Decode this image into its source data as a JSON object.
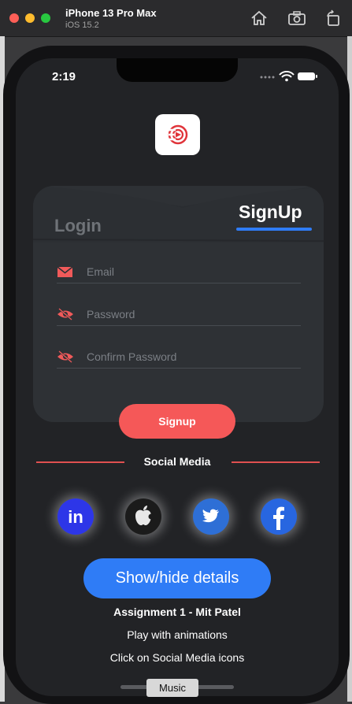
{
  "simulator": {
    "device_name": "iPhone 13 Pro Max",
    "os_version": "iOS 15.2",
    "toolbar_icons": [
      "home-icon",
      "screenshot-icon",
      "rotate-icon"
    ]
  },
  "status_bar": {
    "time": "2:19"
  },
  "auth_card": {
    "tab_login": "Login",
    "tab_signup": "SignUp",
    "active_tab": "SignUp",
    "email_placeholder": "Email",
    "password_placeholder": "Password",
    "confirm_password_placeholder": "Confirm Password",
    "signup_button": "Signup"
  },
  "social": {
    "title": "Social Media",
    "icons": [
      "linkedin-icon",
      "apple-icon",
      "twitter-icon",
      "facebook-icon"
    ],
    "linkedin_text": "in"
  },
  "details": {
    "button_label": "Show/hide details",
    "line1": "Assignment 1 - Mit Patel",
    "line2": "Play with animations",
    "line3": "Click on Social Media icons"
  },
  "tooltip": {
    "text": "Music"
  },
  "colors": {
    "accent_red": "#f55858",
    "accent_blue": "#2f7cf6",
    "background": "#222326",
    "card": "#2e3135"
  }
}
